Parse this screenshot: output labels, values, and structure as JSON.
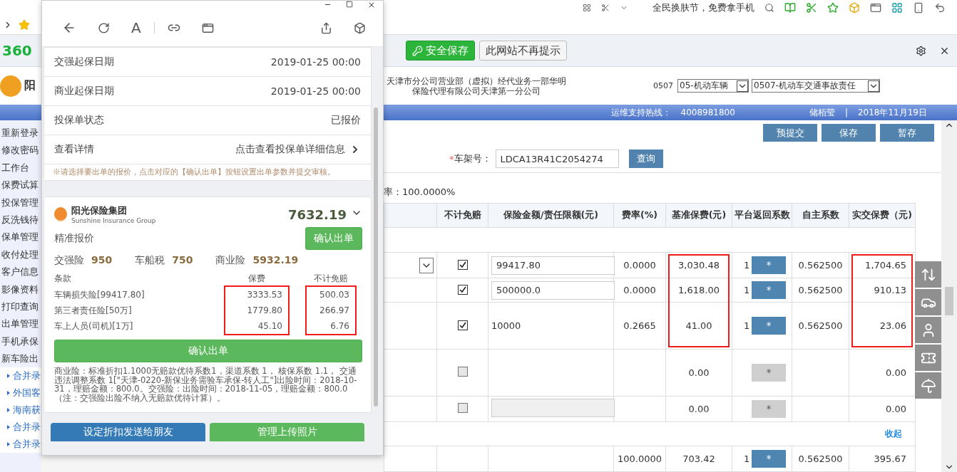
{
  "browser": {
    "search_placeholder": "全民换肤节，免费拿手机"
  },
  "notify_bar": {
    "logo": "360",
    "buttons": [
      {
        "label": "安全保存",
        "kind": "primary"
      },
      {
        "label": "此网站不再提示",
        "kind": "plain"
      }
    ]
  },
  "header": {
    "logo_char": "阳",
    "company": [
      "天津市分公司营业部（虚拟）经代业务一部华明",
      "保险代理有限公司天津第一分公司"
    ],
    "code": "0507",
    "selects": [
      "05-机动车辆",
      "0507-机动车交通事故责任"
    ]
  },
  "info_bar": {
    "hotline_label": "运维支持热线：",
    "hotline": "4008981800",
    "user": "储栢莹",
    "separator": "|",
    "date": "2018年11月19日"
  },
  "sidebar": {
    "items": [
      "重新登录",
      "修改密码",
      "工作台",
      "保费试算",
      "投保管理",
      "反洗钱待",
      "保单管理",
      "收付处理",
      "客户信息",
      "影像资料",
      "打印查询",
      "出单管理",
      "手机承保",
      "新车险出"
    ],
    "sub_items": [
      "合并录",
      "外国客",
      "海南获",
      "合并录",
      "合并录"
    ]
  },
  "actions": [
    "预提交",
    "保存",
    "暂存"
  ],
  "vin": {
    "required_mark": "*",
    "label": "车架号：",
    "value": "LDCA13R41C2054274",
    "button": "查询"
  },
  "rate_text": "率：100.0000%",
  "table": {
    "columns": [
      "不计免赔",
      "保险金额/责任限额(元)",
      "费率(%)",
      "基准保费(元)",
      "平台返回系数",
      "自主系数",
      "实交保费（元)"
    ],
    "rows": [
      {
        "kind": "blank"
      },
      {
        "kind": "data",
        "select": true,
        "exempt": true,
        "amount_input": true,
        "amount": "99417.80",
        "rate": "0.0000",
        "base": "3,030.48",
        "base_marked": true,
        "return_coef": "1",
        "star": "*",
        "star_enabled": true,
        "own_coef": "0.562500",
        "paid": "1,704.65",
        "paid_marked": true
      },
      {
        "kind": "data",
        "exempt": true,
        "amount_input": true,
        "amount": "500000.0",
        "rate": "0.0000",
        "base": "1,618.00",
        "base_marked": true,
        "return_coef": "1",
        "star": "*",
        "star_enabled": true,
        "own_coef": "0.562500",
        "paid": "910.13",
        "paid_marked": true
      },
      {
        "kind": "data",
        "exempt": true,
        "amount_input": false,
        "amount": "10000",
        "rate": "0.2665",
        "base": "41.00",
        "base_marked": true,
        "return_coef": "1",
        "star": "*",
        "star_enabled": true,
        "own_coef": "0.562500",
        "paid": "23.06",
        "paid_marked": true
      },
      {
        "kind": "data",
        "exempt": false,
        "base": "0.00",
        "star": "*",
        "star_enabled": false,
        "paid": "0.00"
      },
      {
        "kind": "data",
        "exempt": false,
        "amount_input": true,
        "amount_disabled": true,
        "base": "0.00",
        "star": "*",
        "star_enabled": false,
        "paid": "0.00"
      },
      {
        "kind": "collapse",
        "label": "收起"
      },
      {
        "kind": "data",
        "rate": "100.0000",
        "base": "703.42",
        "return_coef": "1",
        "star": "*",
        "star_enabled": true,
        "own_coef": "0.562500",
        "paid": "395.67"
      }
    ]
  },
  "popup": {
    "font_button": "A",
    "details": [
      {
        "label": "交强起保日期",
        "value": "2019-01-25 00:00",
        "link": false
      },
      {
        "label": "商业起保日期",
        "value": "2019-01-25 00:00",
        "link": false
      },
      {
        "label": "投保单状态",
        "value": "已报价",
        "link": false
      },
      {
        "label": "查看详情",
        "value": "点击查看投保单详细信息",
        "link": true
      }
    ],
    "note": "※请选择要出单的报价，点击对应的【确认出单】按钮设置出单参数并提交审核。",
    "quote": {
      "company": "阳光保险集团",
      "company_en": "Sunshine Insurance Group",
      "total": "7632.19",
      "title": "精准报价",
      "confirm": "确认出单",
      "summary": [
        {
          "label": "交强险",
          "value": "950"
        },
        {
          "label": "车船税",
          "value": "750"
        },
        {
          "label": "商业险",
          "value": "5932.19"
        }
      ],
      "columns": [
        "条款",
        "保费",
        "不计免赔"
      ],
      "items": [
        {
          "name": "车辆损失险[99417.80]",
          "premium": "3333.53",
          "exempt": "500.03",
          "premium_marked": true,
          "exempt_marked": true
        },
        {
          "name": "第三者责任险[50万]",
          "premium": "1779.80",
          "exempt": "266.97",
          "premium_marked": true,
          "exempt_marked": true
        },
        {
          "name": "车上人员(司机)[1万]",
          "premium": "45.10",
          "exempt": "6.76",
          "premium_marked": true,
          "exempt_marked": true
        }
      ],
      "confirm_wide": "确认出单",
      "remark": "商业险：标准折扣1.1000无赔款优待系数1，渠道系数 1， 核保系数 1.1， 交通违法调整系数 1[\"天津-0220-新保业务需验车承保-转人工\"]出险时间：2018-10-31，理赔金额：800.0。交强险：出险时间：2018-11-05，理赔金额：800.0（注：交强险出险不纳入无赔款优待计算）。"
    },
    "bottom_buttons": [
      {
        "label": "设定折扣发送给朋友",
        "kind": "blue"
      },
      {
        "label": "管理上传照片",
        "kind": "green"
      }
    ]
  }
}
